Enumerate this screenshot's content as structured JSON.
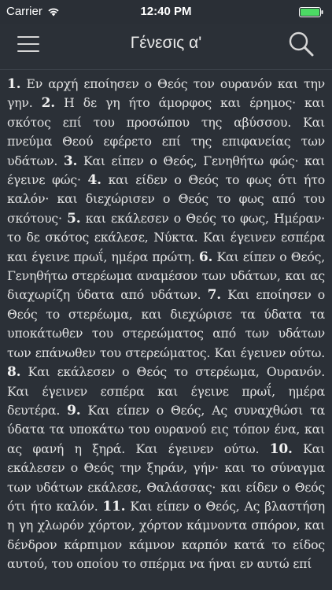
{
  "status_bar": {
    "carrier": "Carrier",
    "time": "12:40 PM",
    "battery_color": "#4cd964"
  },
  "nav": {
    "title": "Γένεσις α'",
    "menu_icon": "hamburger-menu-icon",
    "search_icon": "search-icon"
  },
  "verses": [
    {
      "num": "1.",
      "text": "Εν αρχή εποίησεν ο Θεός τον ουρανόν και την γην."
    },
    {
      "num": "2.",
      "text": "Η δε γη ήτο άμορφος και έρημος· και σκότος επί του προσώπου της αβύσσου. Και πνεύμα Θεού εφέρετο επί της επιφανείας των υδάτων."
    },
    {
      "num": "3.",
      "text": "Και είπεν ο Θεός, Γενηθήτω φώς· και έγεινε φώς·"
    },
    {
      "num": "4.",
      "text": "και είδεν ο Θεός το φως ότι ήτο καλόν· και διεχώρισεν ο Θεός το φως από του σκότους·"
    },
    {
      "num": "5.",
      "text": "και εκάλεσεν ο Θεός το φως, Ημέραν· το δε σκότος εκάλεσε, Νύκτα. Και έγεινεν εσπέρα και έγεινε πρωΐ, ημέρα πρώτη."
    },
    {
      "num": "6.",
      "text": "Και είπεν ο Θεός, Γενηθήτω στερέωμα αναμέσον των υδάτων, και ας διαχωρίζη ύδατα από υδάτων."
    },
    {
      "num": "7.",
      "text": "Και εποίησεν ο Θεός το στερέωμα, και διεχώρισε τα ύδατα τα υποκάτωθεν του στερεώματος από των υδάτων των επάνωθεν του στερεώματος. Και έγεινεν ούτω."
    },
    {
      "num": "8.",
      "text": "Και εκάλεσεν ο Θεός το στερέωμα, Ουρανόν. Και έγεινεν εσπέρα και έγεινε πρωΐ, ημέρα δευτέρα."
    },
    {
      "num": "9.",
      "text": "Και είπεν ο Θεός, Ας συναχθώσι τα ύδατα τα υποκάτω του ουρανού εις τόπον ένα, και ας φανή η ξηρά. Και έγεινεν ούτω."
    },
    {
      "num": "10.",
      "text": "Και εκάλεσεν ο Θεός την ξηράν, γήν· και το σύναγμα των υδάτων εκάλεσε, Θαλάσσας· και είδεν ο Θεός ότι ήτο καλόν."
    },
    {
      "num": "11.",
      "text": "Και είπεν ο Θεός, Ας βλαστήση η γη χλωρόν χόρτον, χόρτον κάμνοντα σπόρον, και δένδρον κάρπιμον κάμνον καρπόν κατά το είδος αυτού, του οποίου το σπέρμα να ήναι εν αυτώ επί"
    }
  ]
}
